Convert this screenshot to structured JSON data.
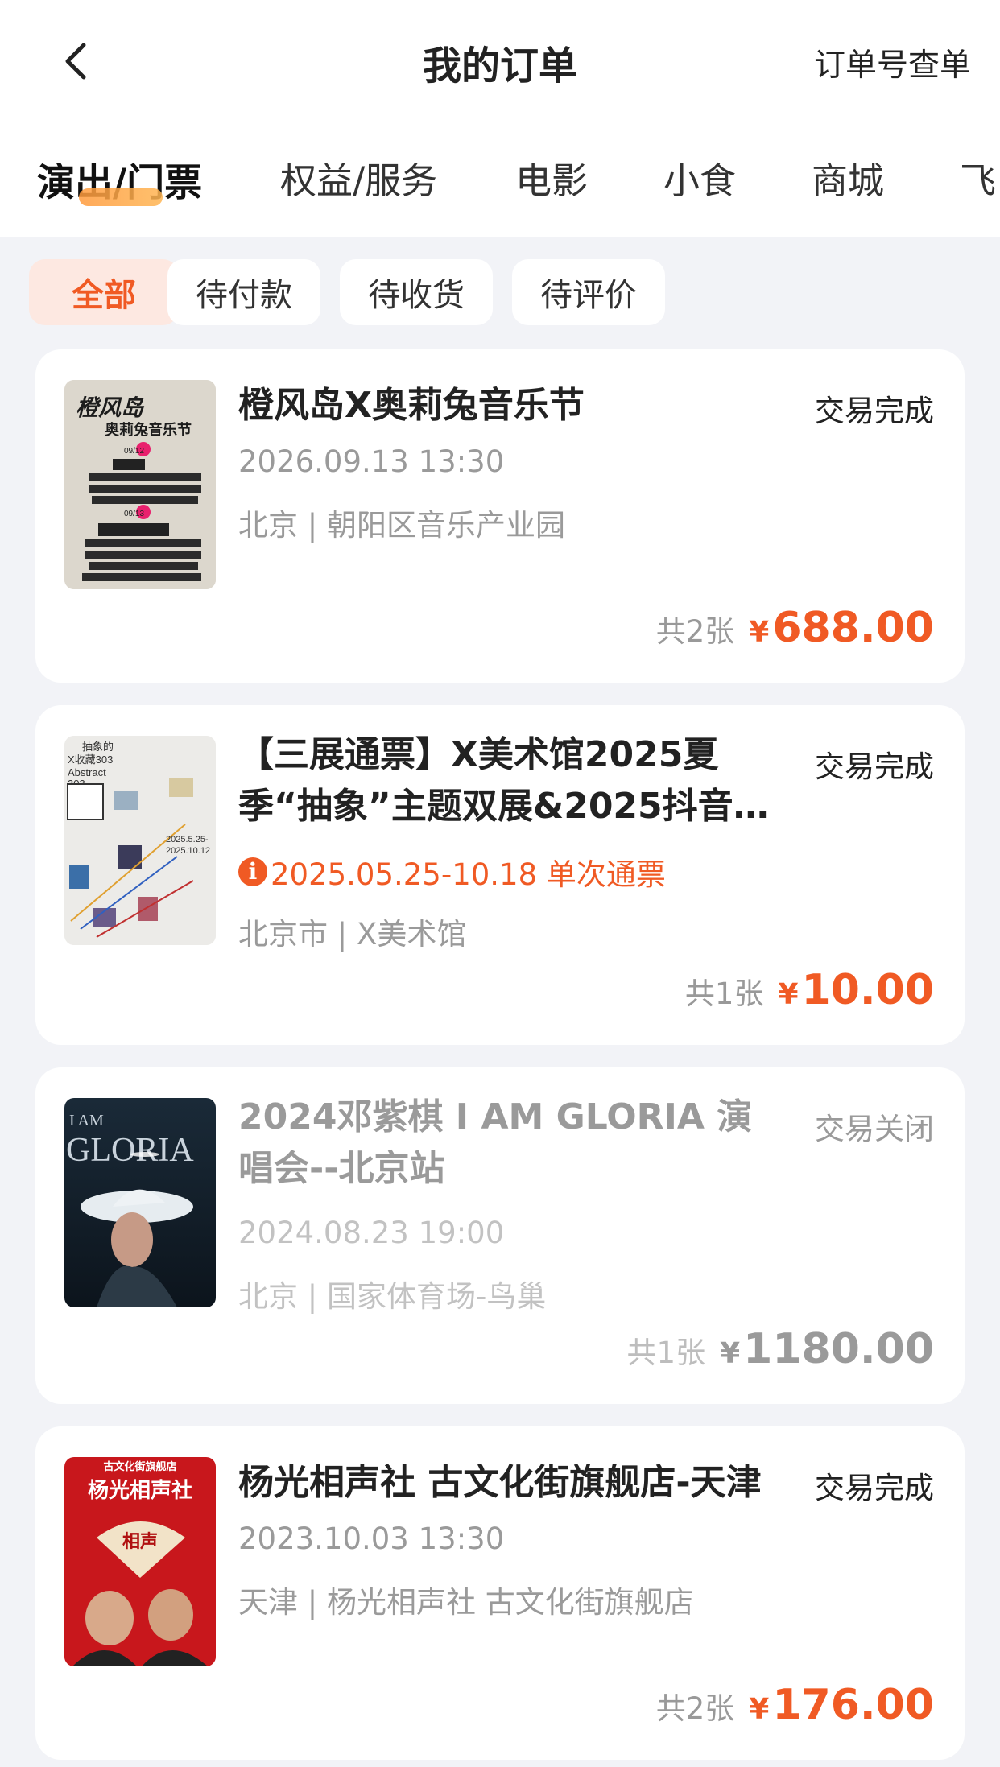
{
  "header": {
    "title": "我的订单",
    "right_link": "订单号查单"
  },
  "categories": [
    "演出/门票",
    "权益/服务",
    "电影",
    "小食",
    "商城",
    "飞"
  ],
  "filters": [
    "全部",
    "待付款",
    "待收货",
    "待评价"
  ],
  "orders": [
    {
      "title": "橙风岛X奥莉兔音乐节",
      "status": "交易完成",
      "datetime": "2026.09.13 13:30",
      "location": "北京 | 朝阳区音乐产业园",
      "count": "共2张",
      "currency": "¥",
      "amount": "688.00",
      "poster_texts": [
        "橙风岛",
        "奥莉兔音乐节",
        "09/12",
        "09/13"
      ]
    },
    {
      "title": "【三展通票】X美术馆2025夏季“抽象”主题双展&2025抖音…",
      "status": "交易完成",
      "notice": "2025.05.25-10.18 单次通票",
      "location": "北京市 | X美术馆",
      "count": "共1张",
      "currency": "¥",
      "amount": "10.00",
      "poster_texts": [
        "抽象的",
        "X收藏303",
        "Abstract",
        "303",
        "2025.5.25-",
        "2025.10.12"
      ]
    },
    {
      "title": "2024邓紫棋 I AM GLORIA 演唱会--北京站",
      "status": "交易关闭",
      "datetime": "2024.08.23 19:00",
      "location": "北京 | 国家体育场-鸟巢",
      "count": "共1张",
      "currency": "¥",
      "amount": "1180.00",
      "poster_texts": [
        "I AM",
        "GLORIA"
      ]
    },
    {
      "title": "杨光相声社 古文化街旗舰店-天津",
      "status": "交易完成",
      "datetime": "2023.10.03 13:30",
      "location": "天津 | 杨光相声社 古文化街旗舰店",
      "count": "共2张",
      "currency": "¥",
      "amount": "176.00",
      "poster_texts": [
        "古文化街旗舰店",
        "杨光相声社",
        "相声"
      ]
    }
  ],
  "colors": {
    "accent": "#f05a24",
    "background": "#f2f3f7",
    "card": "#ffffff",
    "muted": "#9a9a9a"
  },
  "icons": [
    "back-arrow-icon",
    "info-icon"
  ]
}
